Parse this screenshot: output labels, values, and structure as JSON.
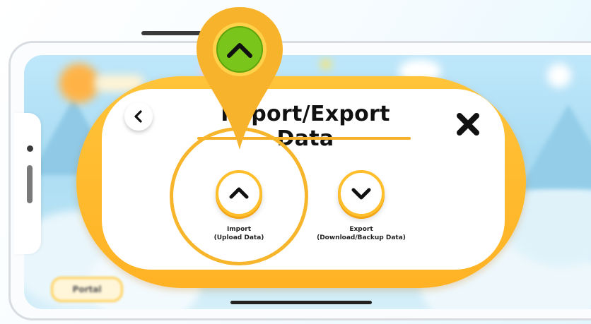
{
  "dialog": {
    "title": "Import/Export Data",
    "back_icon": "chevron-left-icon",
    "close_icon": "close-x-icon",
    "import": {
      "line1": "Import",
      "line2": "(Upload Data)",
      "icon": "chevron-up-icon"
    },
    "export": {
      "line1": "Export",
      "line2": "(Download/Backup Data)",
      "icon": "chevron-down-icon"
    }
  },
  "background": {
    "portal_label": "Portal"
  },
  "pin": {
    "icon": "chevron-up-icon"
  },
  "colors": {
    "accent_orange": "#ffb224",
    "ring": "#f7b52c",
    "pin_green": "#7ac51c",
    "title": "#111111"
  }
}
